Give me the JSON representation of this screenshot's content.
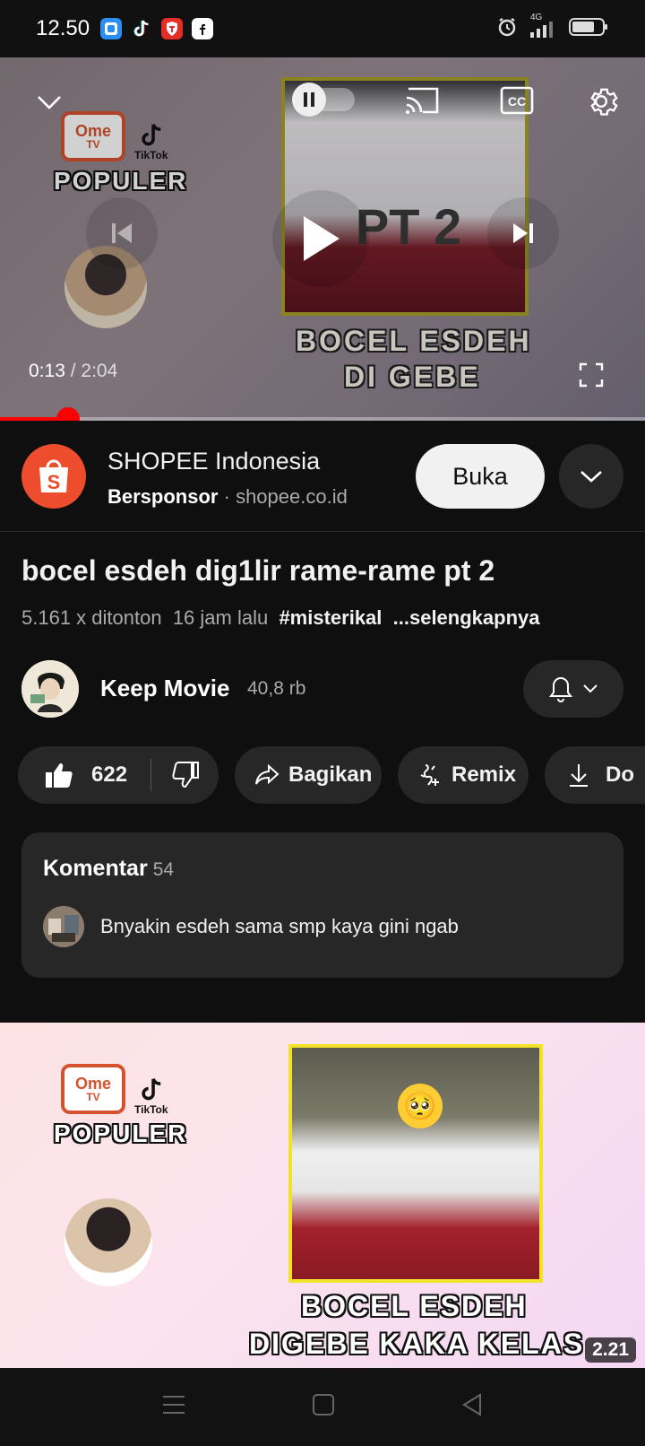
{
  "status_bar": {
    "time": "12.50",
    "network": "4G"
  },
  "player": {
    "current_time": "0:13",
    "duration": "2:04",
    "progress_fraction": 0.105,
    "thumbnail": {
      "brand_ome": "Ome",
      "brand_tv": "TV",
      "brand_tiktok": "TikTok",
      "populer": "POPULER",
      "pt_text": "PT 2",
      "caption_line1": "BOCEL ESDEH",
      "caption_line2": "DI GEBE"
    }
  },
  "ad": {
    "advertiser": "SHOPEE Indonesia",
    "sponsored_label": "Bersponsor",
    "separator": "·",
    "domain": "shopee.co.id",
    "cta": "Buka",
    "brand_color": "#ee4d2d"
  },
  "video": {
    "title": "bocel esdeh dig1lir rame-rame pt 2",
    "views": "5.161 x ditonton",
    "age": "16 jam lalu",
    "hashtag": "#misterikal",
    "more": "...selengkapnya"
  },
  "channel": {
    "name": "Keep Movie",
    "subscribers": "40,8 rb"
  },
  "actions": {
    "likes": "622",
    "share": "Bagikan",
    "remix": "Remix",
    "download": "Do"
  },
  "comments": {
    "label": "Komentar",
    "count": "54",
    "top_comment": "Bnyakin esdeh sama smp kaya gini ngab"
  },
  "next_video": {
    "brand_ome": "Ome",
    "brand_tv": "TV",
    "brand_tiktok": "TikTok",
    "populer": "POPULER",
    "caption_line1": "BOCEL ESDEH",
    "caption_line2": "DIGEBE KAKA KELAS",
    "duration": "2.21"
  },
  "colors": {
    "accent_red": "#ff0000",
    "background": "#0f0f0f",
    "chip": "#272727"
  }
}
